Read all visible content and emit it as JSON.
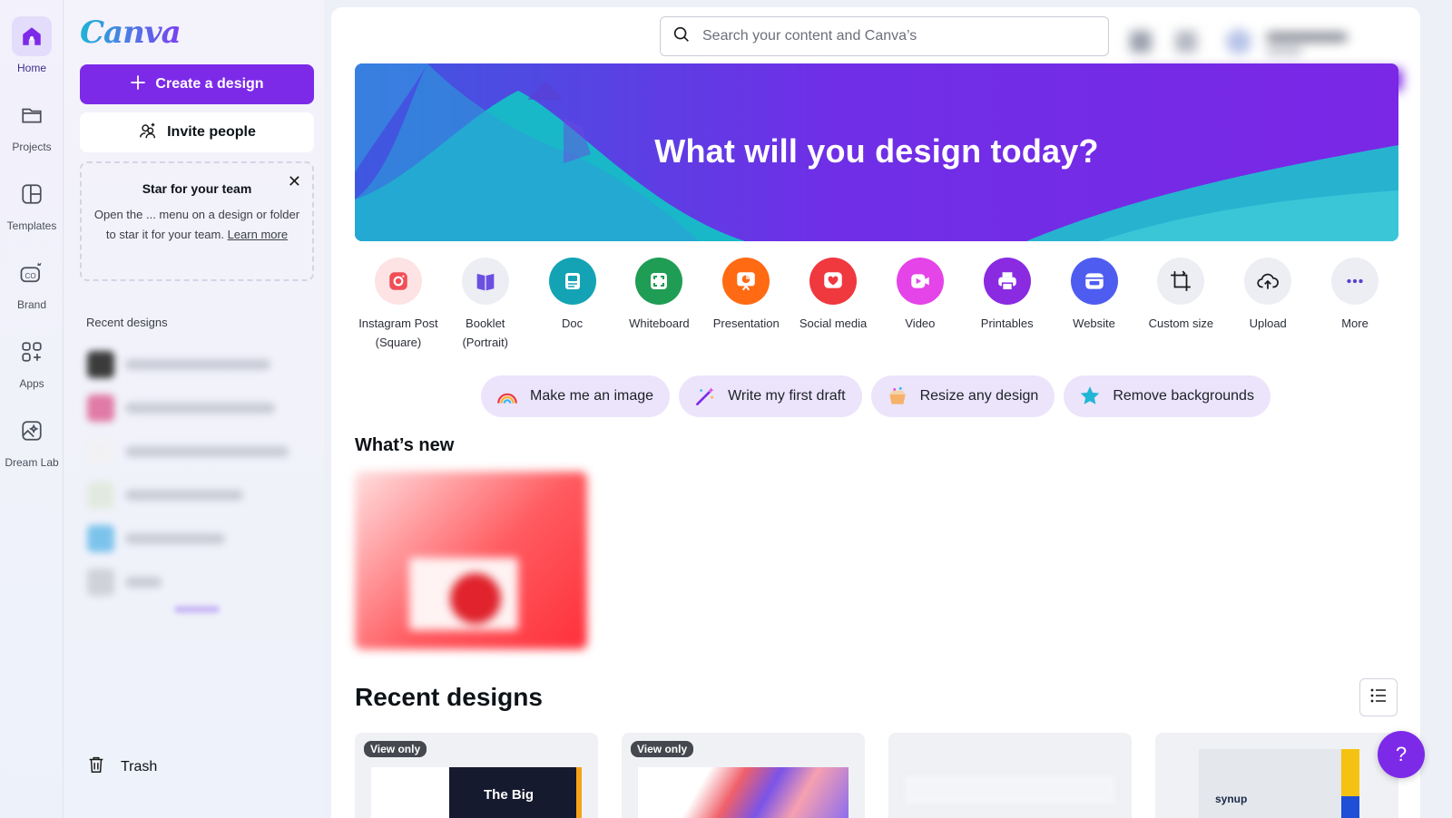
{
  "rail": {
    "home": "Home",
    "projects": "Projects",
    "templates": "Templates",
    "brand": "Brand",
    "apps": "Apps",
    "dream_lab": "Dream Lab"
  },
  "sidebar": {
    "logo": "Canva",
    "create_button": "Create a design",
    "invite_button": "Invite people",
    "star_box": {
      "title": "Star for your team",
      "body": "Open the ... menu on a design or folder to star it for your team. ",
      "link": "Learn more"
    },
    "recent_label": "Recent designs",
    "trash": "Trash"
  },
  "search": {
    "placeholder": "Search your content and Canva’s"
  },
  "hero": {
    "title": "What will you design today?"
  },
  "design_types": [
    {
      "label": "Instagram Post (Square)",
      "icon": "instagram-icon",
      "color": "#fde3e4"
    },
    {
      "label": "Booklet (Portrait)",
      "icon": "booklet-icon",
      "color": "#eceef4"
    },
    {
      "label": "Doc",
      "icon": "doc-icon",
      "color": "#13a3b5"
    },
    {
      "label": "Whiteboard",
      "icon": "whiteboard-icon",
      "color": "#1f9d55"
    },
    {
      "label": "Presentation",
      "icon": "presentation-icon",
      "color": "#ff6a13"
    },
    {
      "label": "Social media",
      "icon": "heart-icon",
      "color": "#f0383f"
    },
    {
      "label": "Video",
      "icon": "video-icon",
      "color": "#e444e8"
    },
    {
      "label": "Printables",
      "icon": "printer-icon",
      "color": "#8a2be2"
    },
    {
      "label": "Website",
      "icon": "website-icon",
      "color": "#4e5cf0"
    },
    {
      "label": "Custom size",
      "icon": "crop-icon",
      "color": "#eceef4"
    },
    {
      "label": "Upload",
      "icon": "upload-cloud-icon",
      "color": "#eceef4"
    },
    {
      "label": "More",
      "icon": "more-icon",
      "color": "#eceef4"
    }
  ],
  "pills": [
    {
      "label": "Make me an image",
      "icon": "rainbow-icon"
    },
    {
      "label": "Write my first draft",
      "icon": "magic-wand-icon"
    },
    {
      "label": "Resize any design",
      "icon": "resize-box-icon"
    },
    {
      "label": "Remove backgrounds",
      "icon": "sparkle-star-icon"
    }
  ],
  "whats_new": "What’s new",
  "recent_designs": {
    "title": "Recent designs",
    "cards": [
      {
        "badge": "View only",
        "text": "The Big"
      },
      {
        "badge": "View only",
        "text": ""
      },
      {
        "badge": "",
        "text": ""
      },
      {
        "badge": "",
        "text": "synup"
      }
    ]
  },
  "help": "?",
  "colors": {
    "brand_purple": "#7d2ae8",
    "hero_start": "#3e58e0",
    "hero_end": "#7a27e6"
  }
}
